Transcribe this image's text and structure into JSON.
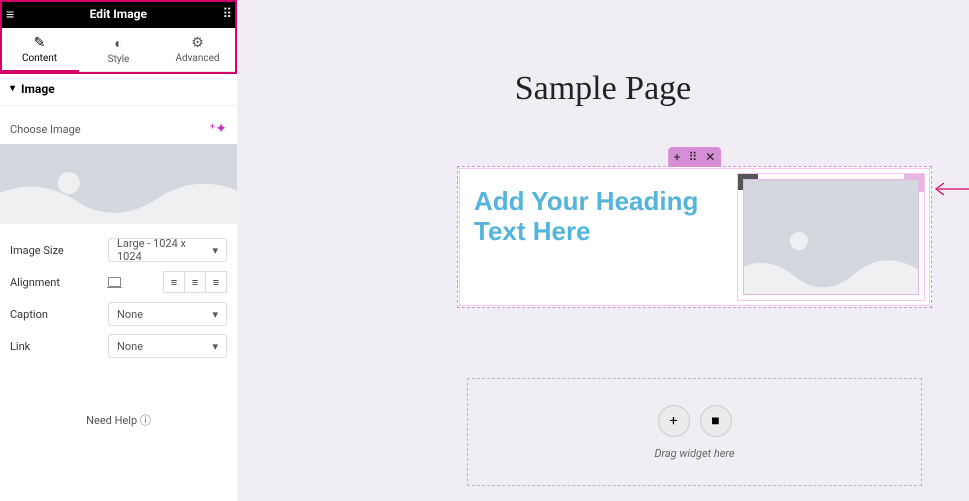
{
  "panel": {
    "title": "Edit Image",
    "tabs": {
      "content": "Content",
      "style": "Style",
      "advanced": "Advanced"
    },
    "section": "Image",
    "choose_image": "Choose Image",
    "image_size_label": "Image Size",
    "image_size_value": "Large - 1024 x 1024",
    "alignment_label": "Alignment",
    "caption_label": "Caption",
    "caption_value": "None",
    "link_label": "Link",
    "link_value": "None",
    "need_help": "Need Help"
  },
  "canvas": {
    "page_title": "Sample Page",
    "heading_text": "Add Your Heading Text Here",
    "drag_text": "Drag widget here"
  },
  "colors": {
    "accent": "#d5006a",
    "heading": "#53b4dc"
  }
}
